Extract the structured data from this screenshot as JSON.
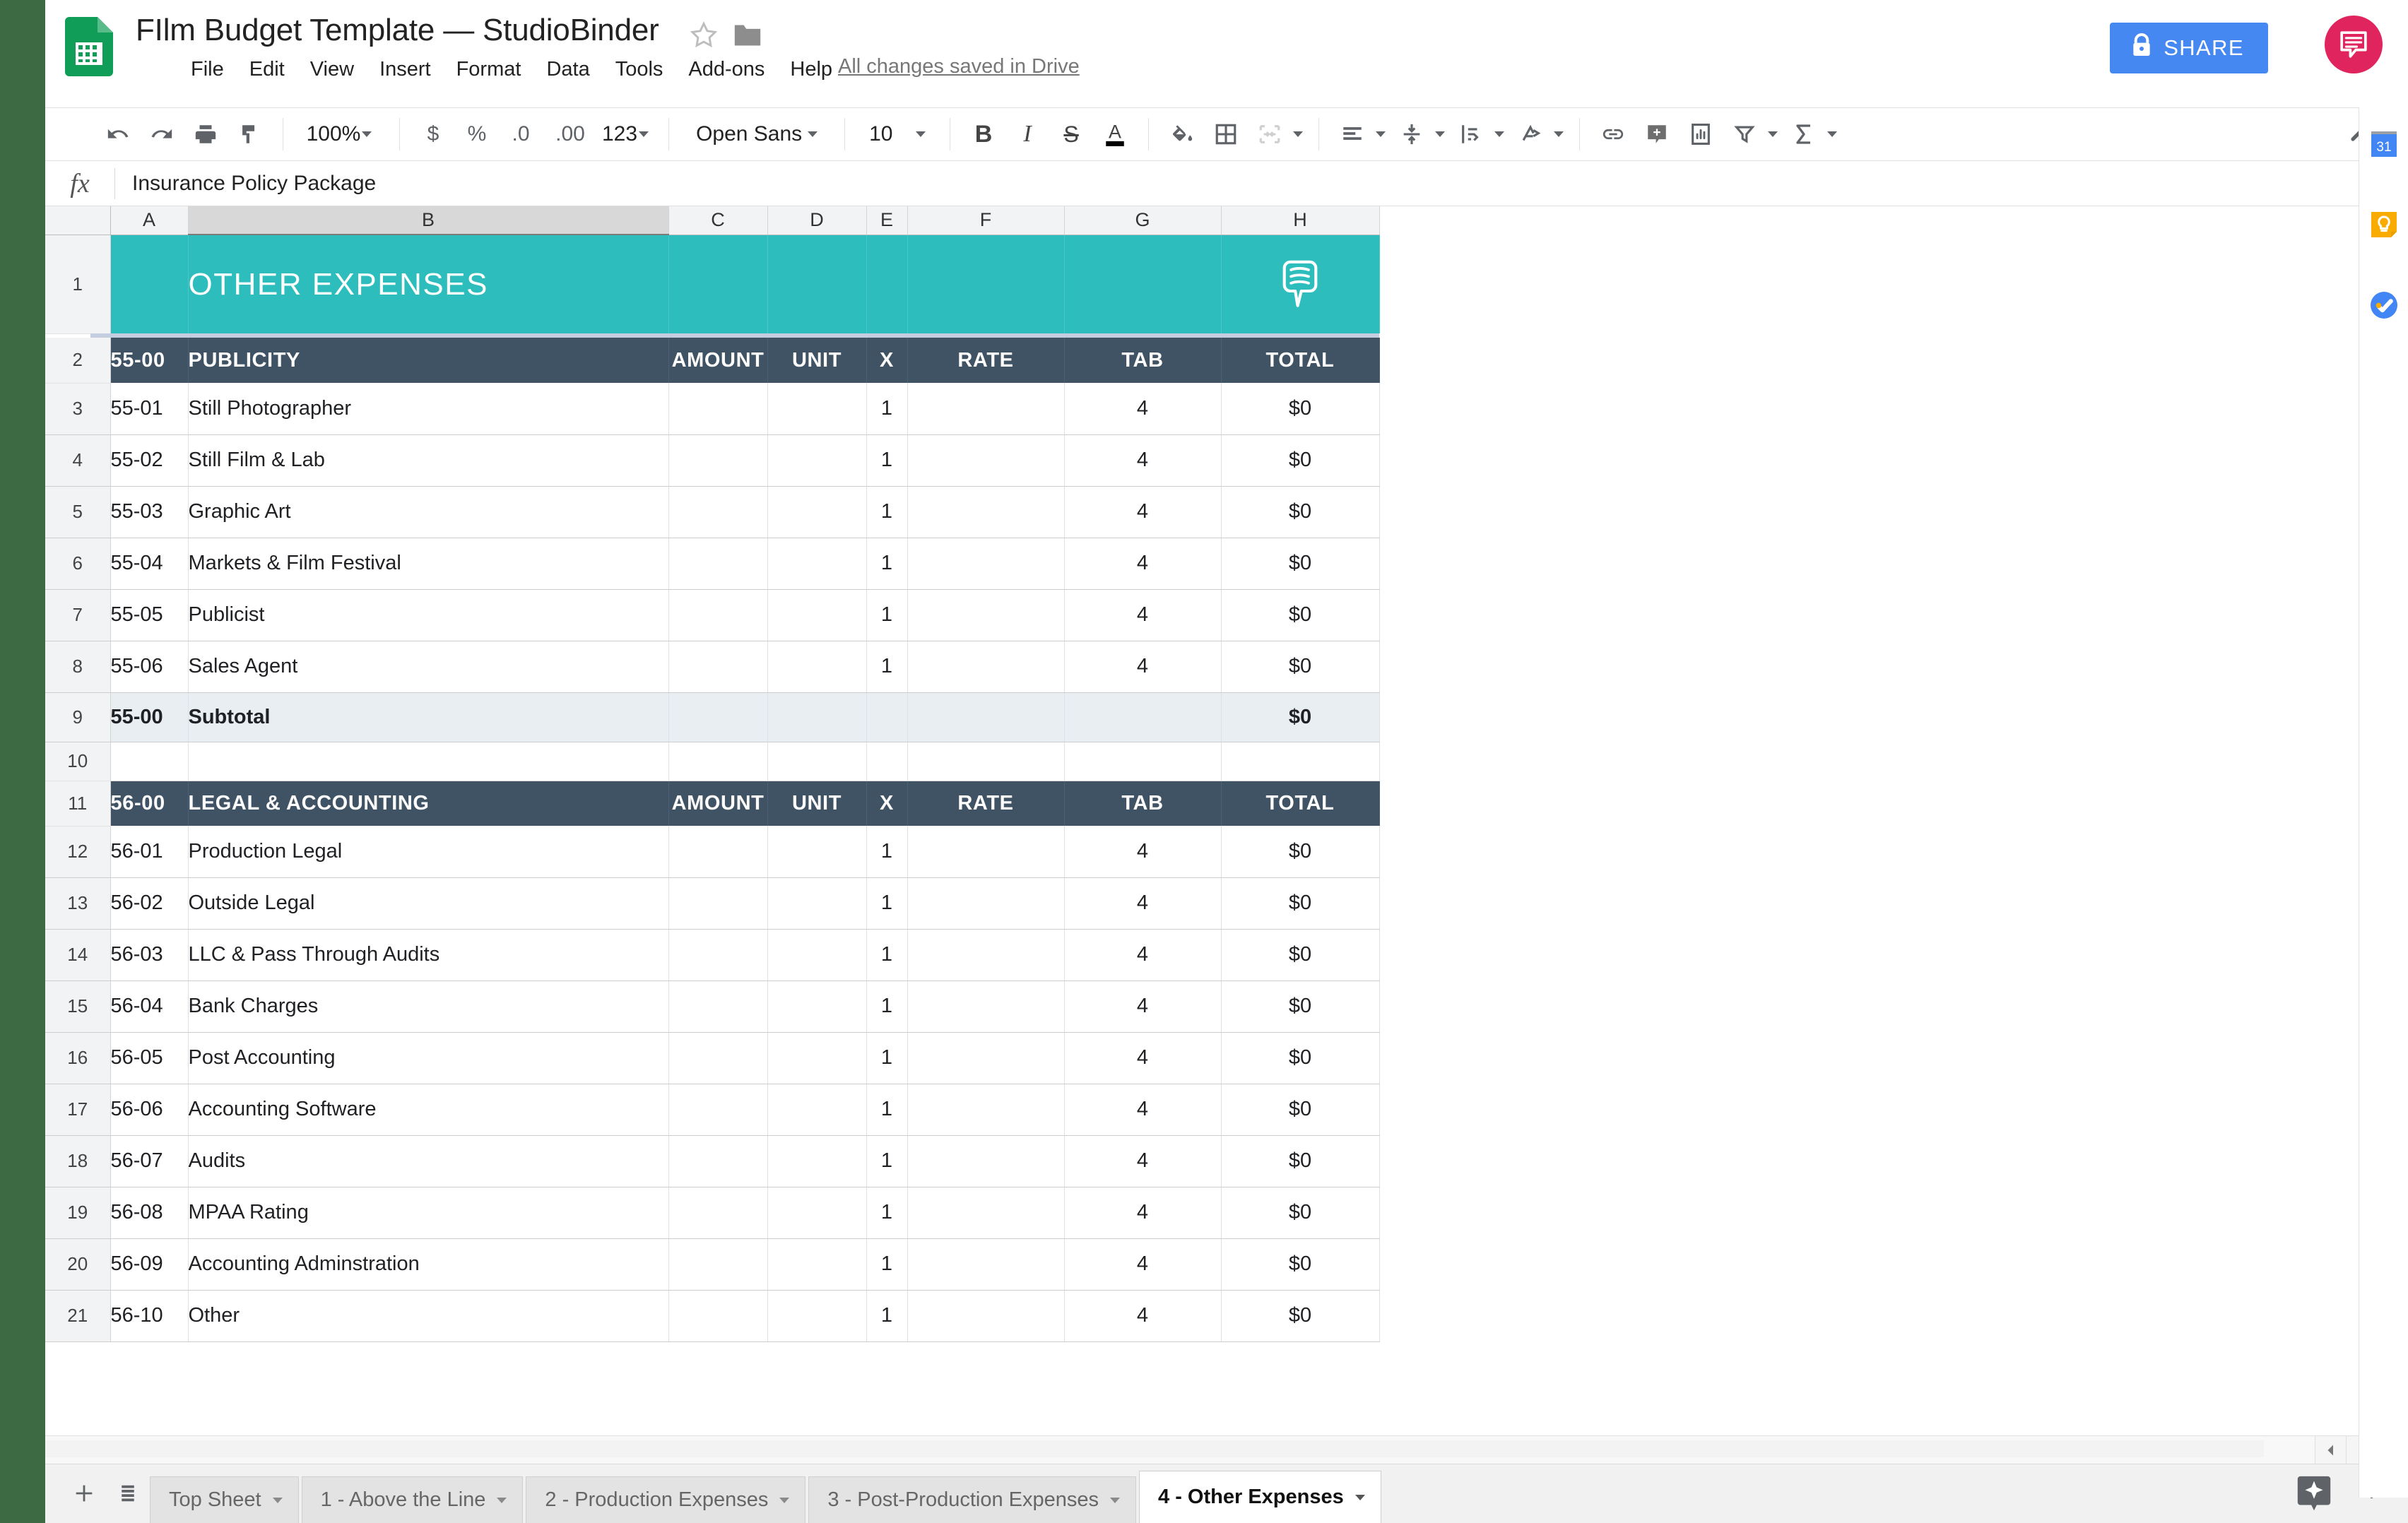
{
  "header": {
    "title": "FIlm Budget Template — StudioBinder",
    "menu": [
      "File",
      "Edit",
      "View",
      "Insert",
      "Format",
      "Data",
      "Tools",
      "Add-ons",
      "Help"
    ],
    "save_state": "All changes saved in Drive",
    "share_label": "SHARE",
    "icons": {
      "logo": "sheets-logo",
      "star": "star-icon",
      "folder": "folder-icon",
      "comment": "comment-icon",
      "lock": "lock-icon",
      "avatar": "user-avatar-chat-icon"
    }
  },
  "toolbar": {
    "zoom": "100%",
    "font": "Open Sans",
    "font_size": "10",
    "number_123": "123",
    "currency": "$",
    "percent": "%",
    "dec_dec": ".0",
    "dec_inc": ".00",
    "bold": "B",
    "italic": "I",
    "strike": "S",
    "text_color": "A"
  },
  "formula_bar": {
    "fx": "fx",
    "value": "Insurance Policy Package"
  },
  "grid": {
    "columns": [
      "A",
      "B",
      "C",
      "D",
      "E",
      "F",
      "G",
      "H"
    ],
    "selected_column": "B",
    "banner": {
      "row": "1",
      "title": "OTHER EXPENSES"
    },
    "header_labels": [
      "AMOUNT",
      "UNIT",
      "X",
      "RATE",
      "TAB",
      "TOTAL"
    ],
    "rows": [
      {
        "n": "2",
        "type": "section",
        "a": "55-00",
        "b": "PUBLICITY",
        "c": "AMOUNT",
        "d": "UNIT",
        "e": "X",
        "f": "RATE",
        "g": "TAB",
        "h": "TOTAL"
      },
      {
        "n": "3",
        "type": "data",
        "a": "55-01",
        "b": "Still Photographer",
        "c": "",
        "d": "",
        "e": "1",
        "f": "",
        "g": "4",
        "h": "$0"
      },
      {
        "n": "4",
        "type": "data",
        "a": "55-02",
        "b": "Still Film & Lab",
        "c": "",
        "d": "",
        "e": "1",
        "f": "",
        "g": "4",
        "h": "$0"
      },
      {
        "n": "5",
        "type": "data",
        "a": "55-03",
        "b": "Graphic Art",
        "c": "",
        "d": "",
        "e": "1",
        "f": "",
        "g": "4",
        "h": "$0"
      },
      {
        "n": "6",
        "type": "data",
        "a": "55-04",
        "b": "Markets & Film Festival",
        "c": "",
        "d": "",
        "e": "1",
        "f": "",
        "g": "4",
        "h": "$0"
      },
      {
        "n": "7",
        "type": "data",
        "a": "55-05",
        "b": "Publicist",
        "c": "",
        "d": "",
        "e": "1",
        "f": "",
        "g": "4",
        "h": "$0"
      },
      {
        "n": "8",
        "type": "data",
        "a": "55-06",
        "b": "Sales Agent",
        "c": "",
        "d": "",
        "e": "1",
        "f": "",
        "g": "4",
        "h": "$0"
      },
      {
        "n": "9",
        "type": "subtotal",
        "a": "55-00",
        "b": "Subtotal",
        "c": "",
        "d": "",
        "e": "",
        "f": "",
        "g": "",
        "h": "$0"
      },
      {
        "n": "10",
        "type": "blank",
        "a": "",
        "b": "",
        "c": "",
        "d": "",
        "e": "",
        "f": "",
        "g": "",
        "h": ""
      },
      {
        "n": "11",
        "type": "section",
        "a": "56-00",
        "b": "LEGAL & ACCOUNTING",
        "c": "AMOUNT",
        "d": "UNIT",
        "e": "X",
        "f": "RATE",
        "g": "TAB",
        "h": "TOTAL"
      },
      {
        "n": "12",
        "type": "data",
        "a": "56-01",
        "b": "Production Legal",
        "c": "",
        "d": "",
        "e": "1",
        "f": "",
        "g": "4",
        "h": "$0"
      },
      {
        "n": "13",
        "type": "data",
        "a": "56-02",
        "b": "Outside Legal",
        "c": "",
        "d": "",
        "e": "1",
        "f": "",
        "g": "4",
        "h": "$0"
      },
      {
        "n": "14",
        "type": "data",
        "a": "56-03",
        "b": "LLC & Pass Through Audits",
        "c": "",
        "d": "",
        "e": "1",
        "f": "",
        "g": "4",
        "h": "$0"
      },
      {
        "n": "15",
        "type": "data",
        "a": "56-04",
        "b": "Bank Charges",
        "c": "",
        "d": "",
        "e": "1",
        "f": "",
        "g": "4",
        "h": "$0"
      },
      {
        "n": "16",
        "type": "data",
        "a": "56-05",
        "b": "Post Accounting",
        "c": "",
        "d": "",
        "e": "1",
        "f": "",
        "g": "4",
        "h": "$0"
      },
      {
        "n": "17",
        "type": "data",
        "a": "56-06",
        "b": "Accounting Software",
        "c": "",
        "d": "",
        "e": "1",
        "f": "",
        "g": "4",
        "h": "$0"
      },
      {
        "n": "18",
        "type": "data",
        "a": "56-07",
        "b": "Audits",
        "c": "",
        "d": "",
        "e": "1",
        "f": "",
        "g": "4",
        "h": "$0"
      },
      {
        "n": "19",
        "type": "data",
        "a": "56-08",
        "b": "MPAA Rating",
        "c": "",
        "d": "",
        "e": "1",
        "f": "",
        "g": "4",
        "h": "$0"
      },
      {
        "n": "20",
        "type": "data",
        "a": "56-09",
        "b": "Accounting Adminstration",
        "c": "",
        "d": "",
        "e": "1",
        "f": "",
        "g": "4",
        "h": "$0"
      },
      {
        "n": "21",
        "type": "data",
        "a": "56-10",
        "b": "Other",
        "c": "",
        "d": "",
        "e": "1",
        "f": "",
        "g": "4",
        "h": "$0"
      }
    ]
  },
  "sheet_tabs": {
    "add_label": "+",
    "tabs": [
      {
        "label": "Top Sheet",
        "active": false
      },
      {
        "label": "1 - Above the Line",
        "active": false
      },
      {
        "label": "2 - Production Expenses",
        "active": false
      },
      {
        "label": "3 - Post-Production Expenses",
        "active": false
      },
      {
        "label": "4 - Other Expenses",
        "active": true
      }
    ]
  },
  "rail": {
    "icons": [
      "calendar-icon",
      "keep-icon",
      "tasks-icon"
    ],
    "calendar_day": "31"
  },
  "colors": {
    "banner_teal": "#2ebdbd",
    "section_navy": "#3f5364",
    "share_blue": "#4688f1",
    "avatar_pink": "#e0245e",
    "frame_green": "#3d6a42",
    "subtotal_bg": "#e8eef2"
  }
}
